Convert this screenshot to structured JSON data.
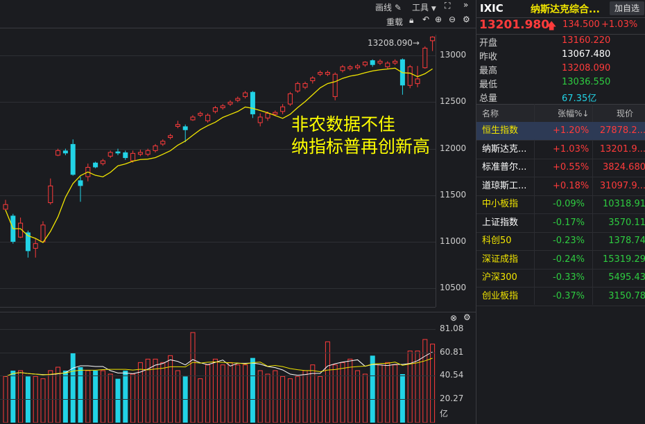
{
  "toolbar": {
    "draw_label": "画线",
    "tools_label": "工具",
    "reset_label": "重载"
  },
  "price_axis": [
    "13000",
    "12500",
    "12000",
    "11500",
    "11000",
    "10500"
  ],
  "vol_axis": [
    "81.08",
    "60.81",
    "40.54",
    "20.27",
    "亿"
  ],
  "high_marker": "13208.090→",
  "news_line1": "非农数据不佳",
  "news_line2": "纳指标普再创新高",
  "colors": {
    "up": "#ff3b3b",
    "down": "#22d3e6",
    "ma": "#f2e600",
    "ma2": "#ffffff"
  },
  "chart_data": {
    "type": "candlestick",
    "ylim": [
      10300,
      13300
    ],
    "candles": [
      {
        "o": 11350,
        "c": 11400,
        "h": 11450,
        "l": 11330
      },
      {
        "o": 11280,
        "c": 11000,
        "h": 11300,
        "l": 10980
      },
      {
        "o": 11050,
        "c": 11200,
        "h": 11260,
        "l": 11040
      },
      {
        "o": 11100,
        "c": 10900,
        "h": 11120,
        "l": 10830
      },
      {
        "o": 10930,
        "c": 10980,
        "h": 11030,
        "l": 10830
      },
      {
        "o": 11000,
        "c": 11180,
        "h": 11220,
        "l": 10990
      },
      {
        "o": 11420,
        "c": 11600,
        "h": 11680,
        "l": 11400
      },
      {
        "o": 11930,
        "c": 11980,
        "h": 12000,
        "l": 11920
      },
      {
        "o": 11980,
        "c": 11950,
        "h": 12000,
        "l": 11930
      },
      {
        "o": 12050,
        "c": 11720,
        "h": 12100,
        "l": 11710
      },
      {
        "o": 11660,
        "c": 11600,
        "h": 11700,
        "l": 11430
      },
      {
        "o": 11700,
        "c": 11800,
        "h": 11840,
        "l": 11650
      },
      {
        "o": 11850,
        "c": 11800,
        "h": 11860,
        "l": 11790
      },
      {
        "o": 11840,
        "c": 11870,
        "h": 11890,
        "l": 11820
      },
      {
        "o": 11920,
        "c": 11960,
        "h": 11980,
        "l": 11900
      },
      {
        "o": 11970,
        "c": 11950,
        "h": 12000,
        "l": 11930
      },
      {
        "o": 11960,
        "c": 11900,
        "h": 11980,
        "l": 11880
      },
      {
        "o": 11870,
        "c": 11950,
        "h": 11980,
        "l": 11850
      },
      {
        "o": 11940,
        "c": 11960,
        "h": 11990,
        "l": 11920
      },
      {
        "o": 11940,
        "c": 11980,
        "h": 12000,
        "l": 11920
      },
      {
        "o": 11980,
        "c": 12030,
        "h": 12050,
        "l": 11960
      },
      {
        "o": 12050,
        "c": 12080,
        "h": 12100,
        "l": 12030
      },
      {
        "o": 12120,
        "c": 12140,
        "h": 12160,
        "l": 12100
      },
      {
        "o": 12240,
        "c": 12260,
        "h": 12300,
        "l": 12220
      },
      {
        "o": 12240,
        "c": 12200,
        "h": 12260,
        "l": 12070
      },
      {
        "o": 12310,
        "c": 12340,
        "h": 12360,
        "l": 12300
      },
      {
        "o": 12360,
        "c": 12380,
        "h": 12400,
        "l": 12340
      },
      {
        "o": 12300,
        "c": 12360,
        "h": 12380,
        "l": 12280
      },
      {
        "o": 12400,
        "c": 12440,
        "h": 12460,
        "l": 12380
      },
      {
        "o": 12440,
        "c": 12460,
        "h": 12480,
        "l": 12420
      },
      {
        "o": 12480,
        "c": 12500,
        "h": 12520,
        "l": 12460
      },
      {
        "o": 12520,
        "c": 12540,
        "h": 12560,
        "l": 12500
      },
      {
        "o": 12560,
        "c": 12600,
        "h": 12620,
        "l": 12540
      },
      {
        "o": 12610,
        "c": 12370,
        "h": 12620,
        "l": 12330
      },
      {
        "o": 12280,
        "c": 12340,
        "h": 12380,
        "l": 12240
      },
      {
        "o": 12330,
        "c": 12380,
        "h": 12400,
        "l": 12300
      },
      {
        "o": 12370,
        "c": 12390,
        "h": 12410,
        "l": 12350
      },
      {
        "o": 12400,
        "c": 12450,
        "h": 12480,
        "l": 12370
      },
      {
        "o": 12480,
        "c": 12590,
        "h": 12610,
        "l": 12460
      },
      {
        "o": 12620,
        "c": 12700,
        "h": 12720,
        "l": 12600
      },
      {
        "o": 12660,
        "c": 12700,
        "h": 12720,
        "l": 12640
      },
      {
        "o": 12730,
        "c": 12760,
        "h": 12780,
        "l": 12700
      },
      {
        "o": 12800,
        "c": 12820,
        "h": 12840,
        "l": 12780
      },
      {
        "o": 12800,
        "c": 12820,
        "h": 12840,
        "l": 12780
      },
      {
        "o": 12560,
        "c": 12800,
        "h": 12820,
        "l": 12520
      },
      {
        "o": 12840,
        "c": 12880,
        "h": 12900,
        "l": 12820
      },
      {
        "o": 12860,
        "c": 12880,
        "h": 12900,
        "l": 12840
      },
      {
        "o": 12870,
        "c": 12890,
        "h": 12910,
        "l": 12850
      },
      {
        "o": 12900,
        "c": 12930,
        "h": 12940,
        "l": 12880
      },
      {
        "o": 12950,
        "c": 12900,
        "h": 12960,
        "l": 12880
      },
      {
        "o": 12920,
        "c": 12940,
        "h": 12960,
        "l": 12900
      },
      {
        "o": 12880,
        "c": 12920,
        "h": 12940,
        "l": 12860
      },
      {
        "o": 12920,
        "c": 12940,
        "h": 12960,
        "l": 12900
      },
      {
        "o": 12960,
        "c": 12680,
        "h": 12970,
        "l": 12580
      },
      {
        "o": 12680,
        "c": 12880,
        "h": 12900,
        "l": 12650
      },
      {
        "o": 12700,
        "c": 12750,
        "h": 12890,
        "l": 12660
      },
      {
        "o": 12870,
        "c": 13080,
        "h": 13100,
        "l": 12860
      },
      {
        "o": 13160,
        "c": 13200,
        "h": 13208,
        "l": 13050
      }
    ]
  },
  "panel": {
    "symbol": "IXIC",
    "name": "纳斯达克综合...",
    "add_button": "加自选",
    "price": "13201.980",
    "change": "134.500",
    "change_pct": "+1.03%",
    "stats": [
      {
        "label": "开盘",
        "value": "13160.220",
        "cls": "red"
      },
      {
        "label": "昨收",
        "value": "13067.480",
        "cls": "white"
      },
      {
        "label": "最高",
        "value": "13208.090",
        "cls": "red"
      },
      {
        "label": "最低",
        "value": "13036.550",
        "cls": "green"
      },
      {
        "label": "总量",
        "value": "67.35亿",
        "cls": "cyan"
      }
    ],
    "table_headers": {
      "name": "名称",
      "pct": "张幅%↓",
      "price": "现价"
    },
    "indices": [
      {
        "name": "恒生指数",
        "pct": "+1.20%",
        "price": "27878.2...",
        "ncls": "yellow",
        "vcls": "red",
        "sel": true
      },
      {
        "name": "纳斯达克...",
        "pct": "+1.03%",
        "price": "13201.9...",
        "ncls": "white",
        "vcls": "red",
        "sel": false
      },
      {
        "name": "标准普尔...",
        "pct": "+0.55%",
        "price": "3824.680",
        "ncls": "white",
        "vcls": "red",
        "sel": false
      },
      {
        "name": "道琼斯工...",
        "pct": "+0.18%",
        "price": "31097.9...",
        "ncls": "white",
        "vcls": "red",
        "sel": false
      },
      {
        "name": "中小板指",
        "pct": "-0.09%",
        "price": "10318.91",
        "ncls": "yellow",
        "vcls": "green",
        "sel": false
      },
      {
        "name": "上证指数",
        "pct": "-0.17%",
        "price": "3570.11",
        "ncls": "white",
        "vcls": "green",
        "sel": false
      },
      {
        "name": "科创50",
        "pct": "-0.23%",
        "price": "1378.74",
        "ncls": "yellow",
        "vcls": "green",
        "sel": false
      },
      {
        "name": "深证成指",
        "pct": "-0.24%",
        "price": "15319.29",
        "ncls": "yellow",
        "vcls": "green",
        "sel": false
      },
      {
        "name": "沪深300",
        "pct": "-0.33%",
        "price": "5495.43",
        "ncls": "yellow",
        "vcls": "green",
        "sel": false
      },
      {
        "name": "创业板指",
        "pct": "-0.37%",
        "price": "3150.78",
        "ncls": "yellow",
        "vcls": "green",
        "sel": false
      }
    ]
  }
}
